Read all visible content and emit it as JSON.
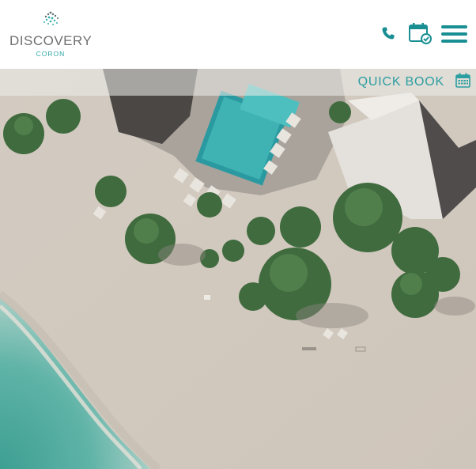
{
  "logo": {
    "name": "DISCOVERY",
    "sub": "CORON"
  },
  "header": {
    "icons": {
      "phone": "phone-icon",
      "booking": "calendar-check-icon",
      "menu": "hamburger-menu-icon"
    }
  },
  "quick_book": {
    "label": "QUICK BOOK",
    "icon": "calendar-grid-icon"
  },
  "hero": {
    "image_subject": "aerial-beach-resort-photo"
  },
  "colors": {
    "accent": "#2a9ea0",
    "logo_text": "#6f6f6f",
    "nav_icon": "#1a8f93"
  }
}
